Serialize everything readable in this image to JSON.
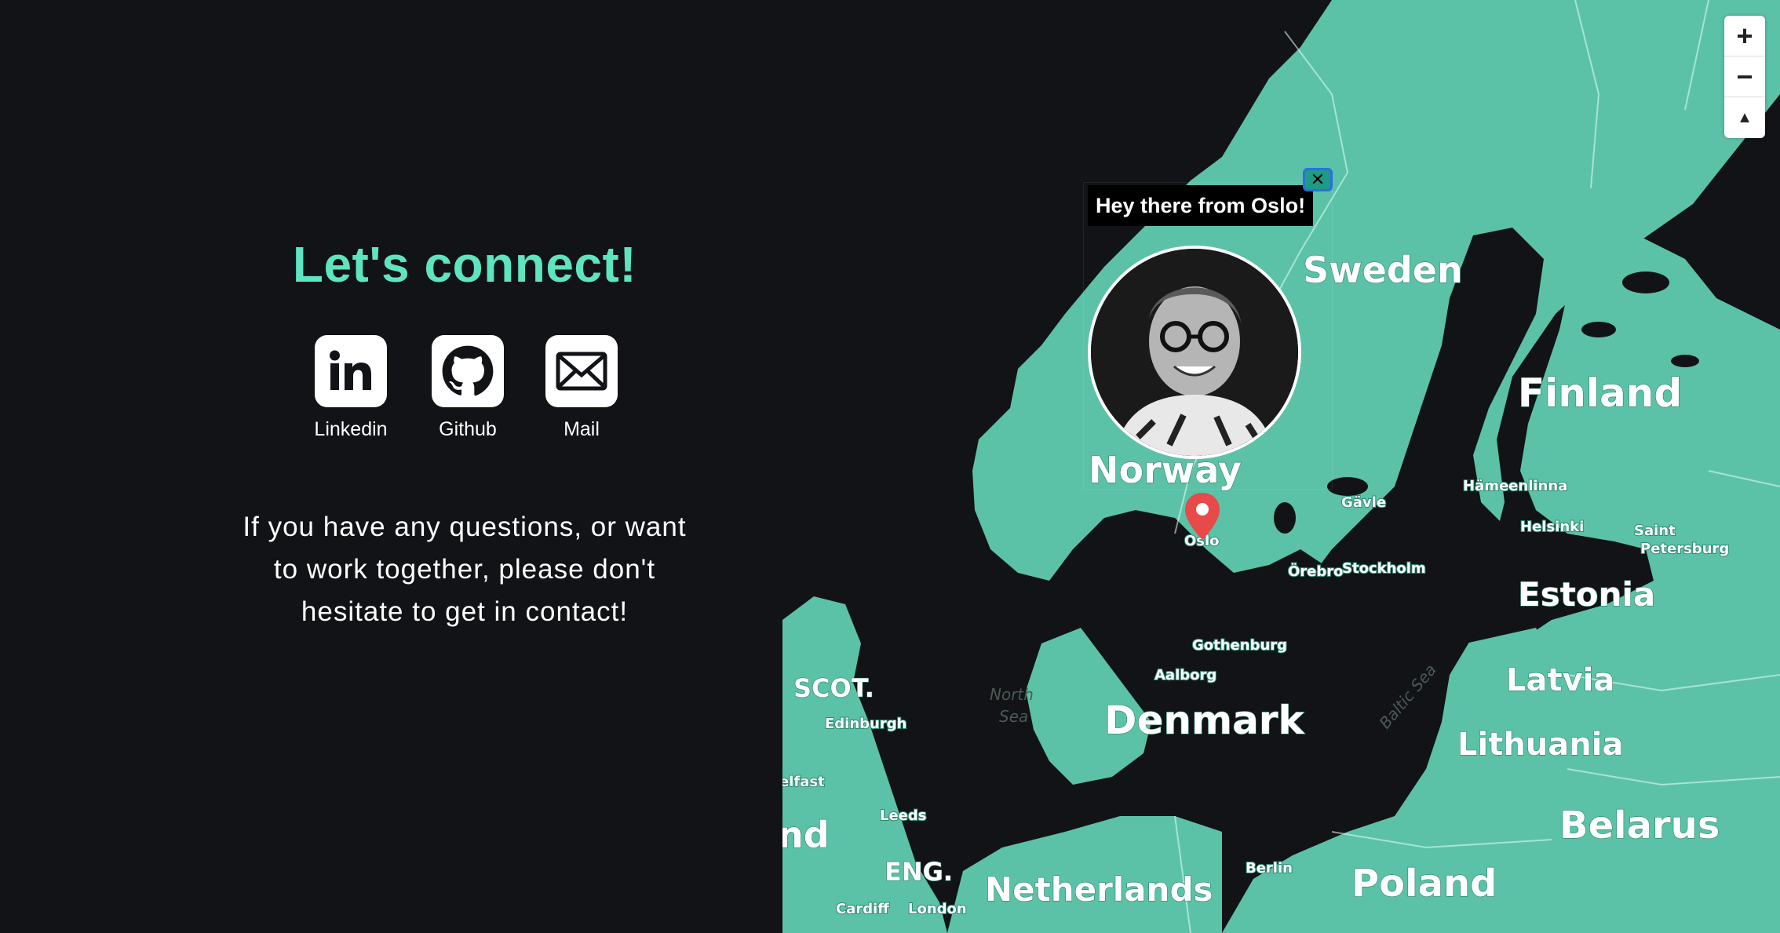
{
  "contact": {
    "title": "Let's connect!",
    "links": [
      {
        "label": "Linkedin",
        "icon": "linkedin-icon"
      },
      {
        "label": "Github",
        "icon": "github-icon"
      },
      {
        "label": "Mail",
        "icon": "mail-icon"
      }
    ],
    "message_lines": [
      "If you have any questions, or want",
      "to work together, please don't",
      "hesitate to get in contact!"
    ]
  },
  "map": {
    "popup_text": "Hey there from Oslo!",
    "close_glyph": "✕",
    "zoom_in": "+",
    "zoom_out": "−",
    "compass": "▲",
    "countries": [
      "Sweden",
      "Finland",
      "Norway",
      "Estonia",
      "Latvia",
      "Lithuania",
      "Denmark",
      "Belarus",
      "Poland",
      "Netherlands",
      "SCOT.",
      "ENG.",
      "nd"
    ],
    "cities": [
      "Oslo",
      "Gävle",
      "Hämeenlinna",
      "Helsinki",
      "Saint",
      "Petersburg",
      "Örebro",
      "Stockholm",
      "Gothenburg",
      "Aalborg",
      "Edinburgh",
      "Leeds",
      "Berlin",
      "Cardiff",
      "London",
      "elfast"
    ],
    "seas": [
      "North",
      "Sea",
      "Baltic Sea"
    ],
    "land_color": "#5bc2a8",
    "water_color": "#121316"
  }
}
